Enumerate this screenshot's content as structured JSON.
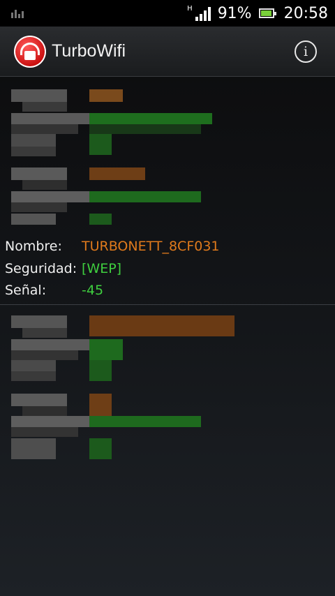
{
  "status_bar": {
    "network_type": "H",
    "battery_percent": "91%",
    "time": "20:58",
    "icons": [
      "signal-bars-icon",
      "battery-icon",
      "notification-icon"
    ]
  },
  "action_bar": {
    "app_title": "TurboWifi",
    "info_icon_glyph": "i"
  },
  "selected_network": {
    "name_label": "Nombre:",
    "name_value": "TURBONETT_8CF031",
    "security_label": "Seguridad:",
    "security_value": "[WEP]",
    "signal_label": "Señal:",
    "signal_value": "-45"
  },
  "colors": {
    "name_color": "#e07a1c",
    "security_color": "#3fcf3f",
    "signal_color": "#3fcf3f",
    "divider": "#3c3f44"
  }
}
